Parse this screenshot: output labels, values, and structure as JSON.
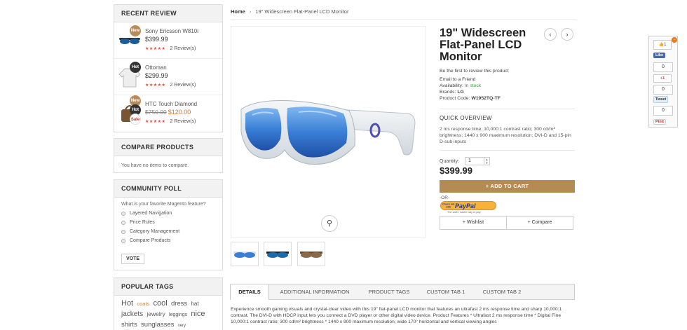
{
  "sidebar": {
    "recent_review": {
      "title": "RECENT REVIEW",
      "items": [
        {
          "name": "Sony Ericsson W810i",
          "price": "$399.99",
          "badge": "New",
          "reviews": "2 Review(s)",
          "rating": "★★★★★",
          "thumb": "sunglasses-thumb"
        },
        {
          "name": "Ottoman",
          "price": "$299.99",
          "badge": "Hot",
          "reviews": "2 Review(s)",
          "rating": "★★★★★",
          "thumb": "sweater-thumb"
        },
        {
          "name": "HTC Touch Diamond",
          "old_price": "$750.00",
          "price": "$120.00",
          "badges": [
            "New",
            "Hot",
            "Sale"
          ],
          "reviews": "2 Review(s)",
          "rating": "★★★★★",
          "thumb": "handbag-thumb"
        }
      ]
    },
    "compare": {
      "title": "COMPARE PRODUCTS",
      "text": "You have no items to compare."
    },
    "poll": {
      "title": "COMMUNITY POLL",
      "question": "What is your favorite Magento feature?",
      "options": [
        "Layered Navigation",
        "Price Rules",
        "Category Management",
        "Compare Products"
      ],
      "vote_label": "VOTE"
    },
    "tags": {
      "title": "POPULAR TAGS",
      "items": [
        "Hot",
        "coats",
        "cool",
        "dress",
        "hat",
        "jackets",
        "jewelry",
        "leggings",
        "nice",
        "shirts",
        "sunglasses",
        "very"
      ]
    }
  },
  "breadcrumb": {
    "home": "Home",
    "separator": "›",
    "current": "19\" Widescreen Flat-Panel LCD Monitor"
  },
  "product": {
    "title": "19\" Widescreen Flat-Panel LCD Monitor",
    "review_link": "Be the first to review this product",
    "email_friend": "Email to a Friend",
    "availability_label": "Availability:",
    "availability_value": "In stock",
    "brand_label": "Brands:",
    "brand_value": "LG",
    "code_label": "Product Code:",
    "code_value": "W1952TQ-TF",
    "quick_overview_title": "QUICK OVERVIEW",
    "quick_overview_text": "2 ms response time; 10,000:1 contrast ratio; 300 cd/m² brightness; 1440 x 900 maximum resolution; DVI-D and 15-pin D-sub inputs",
    "qty_label": "Quantity:",
    "qty_value": "1",
    "price": "$399.99",
    "add_to_cart": "+ ADD TO CART",
    "or_label": "-OR-",
    "paypal_top": "Check out",
    "paypal_with": "with",
    "paypal_brand": "PayPal",
    "paypal_tagline": "The safer, easier way to pay",
    "wishlist": "+ Wishlist",
    "compare": "+ Compare",
    "prev_icon": "‹",
    "next_icon": "›"
  },
  "tabs": {
    "items": [
      "DETAILS",
      "ADDITIONAL INFORMATION",
      "PRODUCT TAGS",
      "CUSTOM TAB 1",
      "CUSTOM TAB 2"
    ],
    "active": "DETAILS"
  },
  "description": "Experience smooth gaming visuals and crystal-clear video with this 19\" flat-panel LCD monitor that features an ultrafast 2 ms response time and sharp 10,000:1 contrast. The DVI-D with HDCP input lets you connect a DVD player or other digital video device. Product Features * Ultrafast 2 ms response time * Digital Fine 10,000:1 contrast ratio; 300 cd/m² brightness * 1440 x 900 maximum resolution; wide 170° horizontal and vertical viewing angles",
  "social": {
    "like_count": "1",
    "fb_like": "Like",
    "fb_count": "0",
    "gplus": "+1",
    "gplus_count": "0",
    "tweet": "Tweet",
    "tweet_count": "0",
    "pinit": "Pinit",
    "close": "−"
  },
  "colors": {
    "accent": "#b48a55",
    "instock": "#3a9a3a",
    "sale_price": "#c8763a",
    "stars": "#d84a3a",
    "lens_blue": "#3a7fd6"
  }
}
